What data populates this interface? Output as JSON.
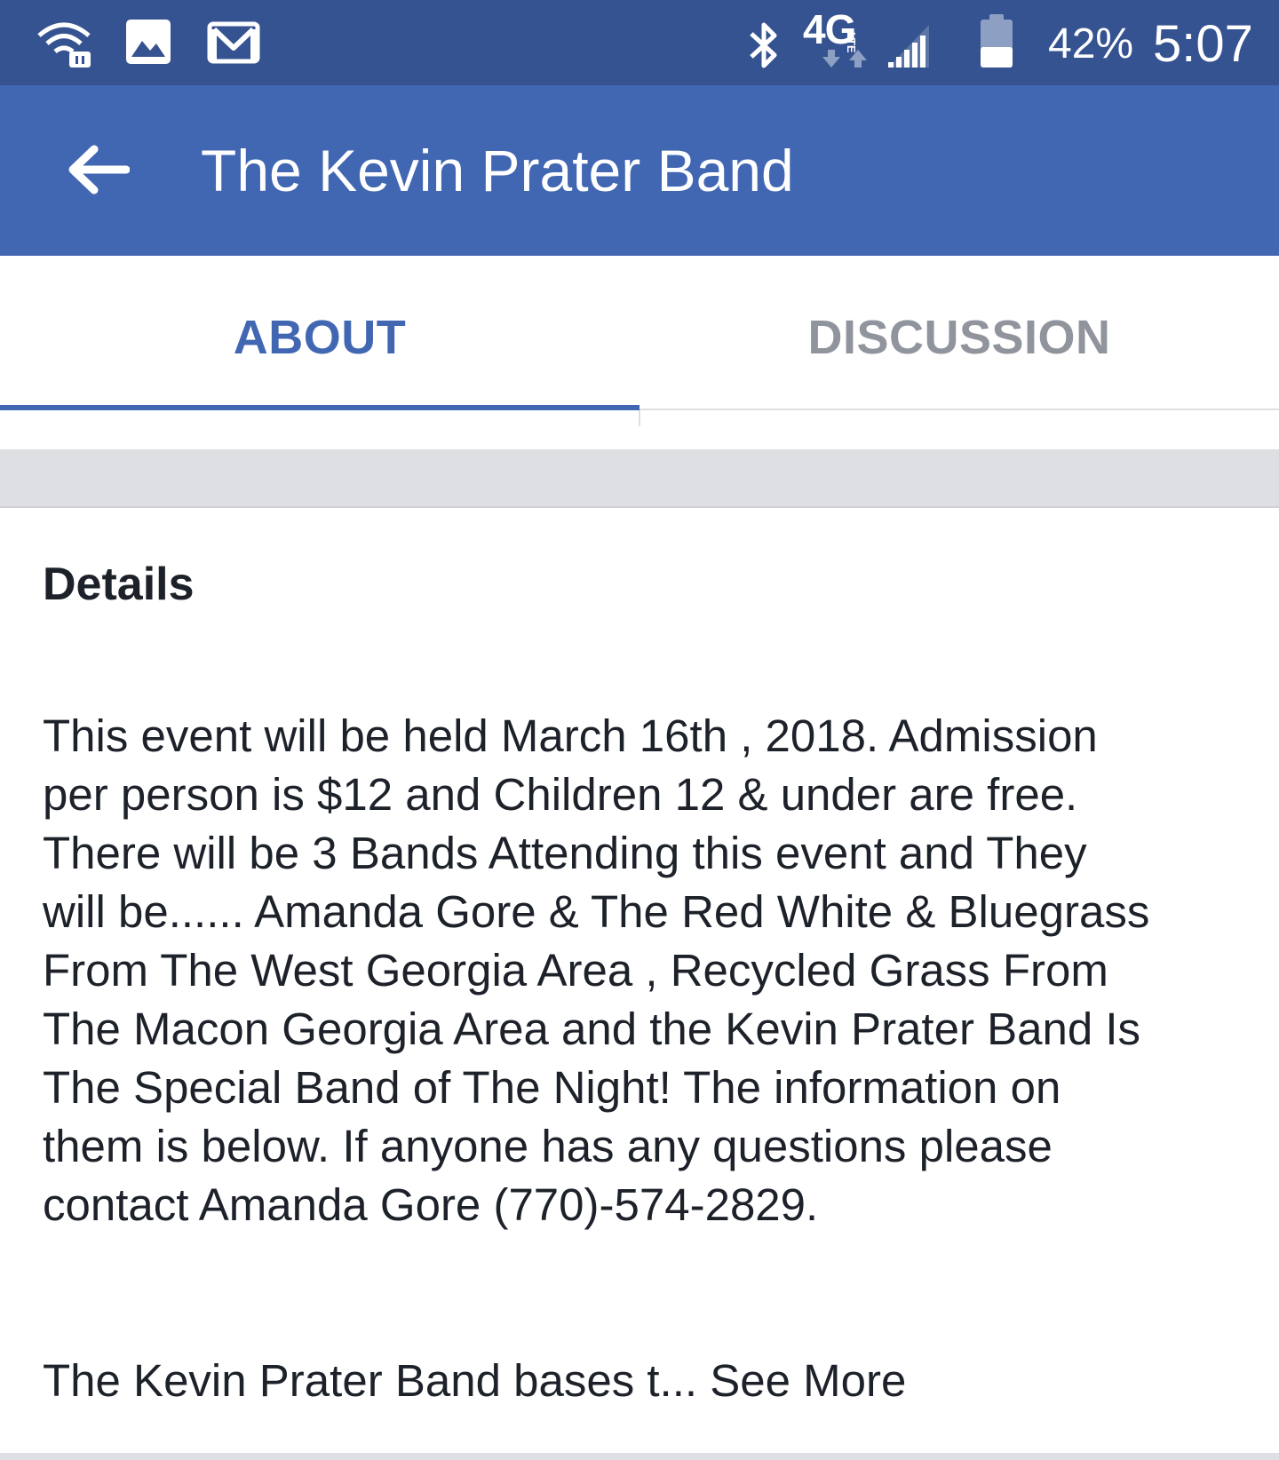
{
  "status_bar": {
    "network_label": "4G",
    "lte_label": "LTE",
    "battery_percent": "42%",
    "battery_level": 0.42,
    "time": "5:07",
    "icons": [
      "wifi-calling-icon",
      "image-icon",
      "gmail-icon",
      "bluetooth-icon",
      "signal-icon",
      "battery-icon"
    ]
  },
  "header": {
    "title": "The Kevin Prater Band",
    "back_icon": "back-arrow-icon"
  },
  "tabs": [
    {
      "label": "ABOUT",
      "active": true
    },
    {
      "label": "DISCUSSION",
      "active": false
    }
  ],
  "details": {
    "heading": "Details",
    "lines": [
      "This event will be held March 16th , 2018. Admission",
      "per person is $12 and Children 12 & under are free.",
      "There will be 3 Bands Attending this event and They",
      "will be...... Amanda Gore & The Red White & Bluegrass",
      "From The West Georgia Area , Recycled Grass From",
      "The Macon Georgia Area and the Kevin Prater Band Is",
      "The Special Band of The Night! The information on",
      "them is below. If anyone has any questions please",
      "contact Amanda Gore (770)-574-2829."
    ],
    "truncated_text": "The Kevin Prater Band bases t...",
    "see_more_label": "See More"
  },
  "colors": {
    "status_bar": "#365391",
    "app_bar": "#4267b2",
    "active_tab": "#4267b2",
    "inactive_tab": "#90949c",
    "separator": "#dddfe2",
    "body_text": "#1d2129"
  }
}
